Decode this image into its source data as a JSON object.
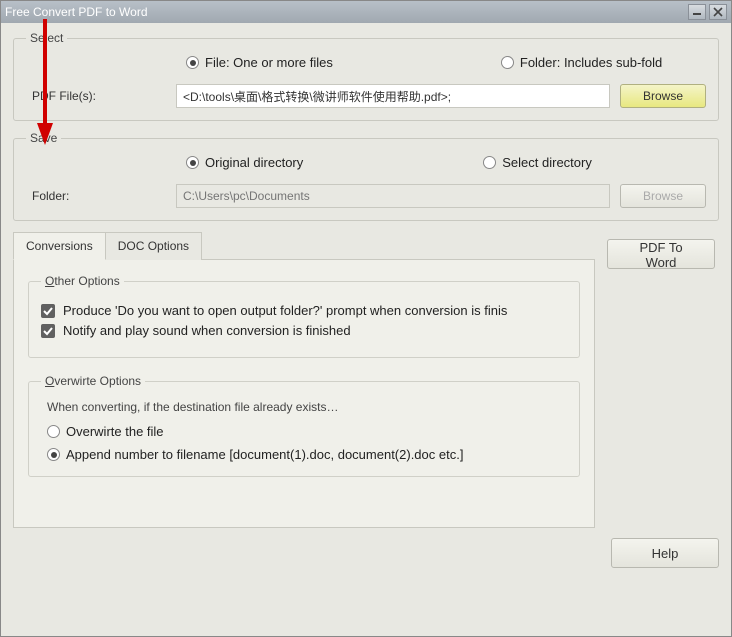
{
  "title": "Free Convert PDF to Word",
  "select": {
    "legend": "Select",
    "radioFile": "File:  One or more files",
    "radioFolder": "Folder: Includes sub-fold",
    "labelFiles": "PDF File(s):",
    "path": "<D:\\tools\\桌面\\格式转换\\微讲师软件使用帮助.pdf>;",
    "browse": "Browse"
  },
  "save": {
    "legend": "Save",
    "radioOriginal": "Original directory",
    "radioSelect": "Select directory",
    "labelFolder": "Folder:",
    "placeholder": "C:\\Users\\pc\\Documents",
    "browse": "Browse"
  },
  "tabs": {
    "conversions": "Conversions",
    "docOptions": "DOC Options"
  },
  "otherOptions": {
    "legend": "Other Options",
    "c1": "Produce 'Do you want to open output folder?' prompt when conversion is finis",
    "c2": "Notify and play sound when conversion is finished"
  },
  "overwrite": {
    "legend": "Overwirte Options",
    "hint": "When converting, if the destination file already exists…",
    "r1": "Overwirte the file",
    "r2": "Append number to filename  [document(1).doc, document(2).doc etc.]"
  },
  "sideButtons": {
    "pdfToWord": "PDF To Word",
    "help": "Help"
  }
}
